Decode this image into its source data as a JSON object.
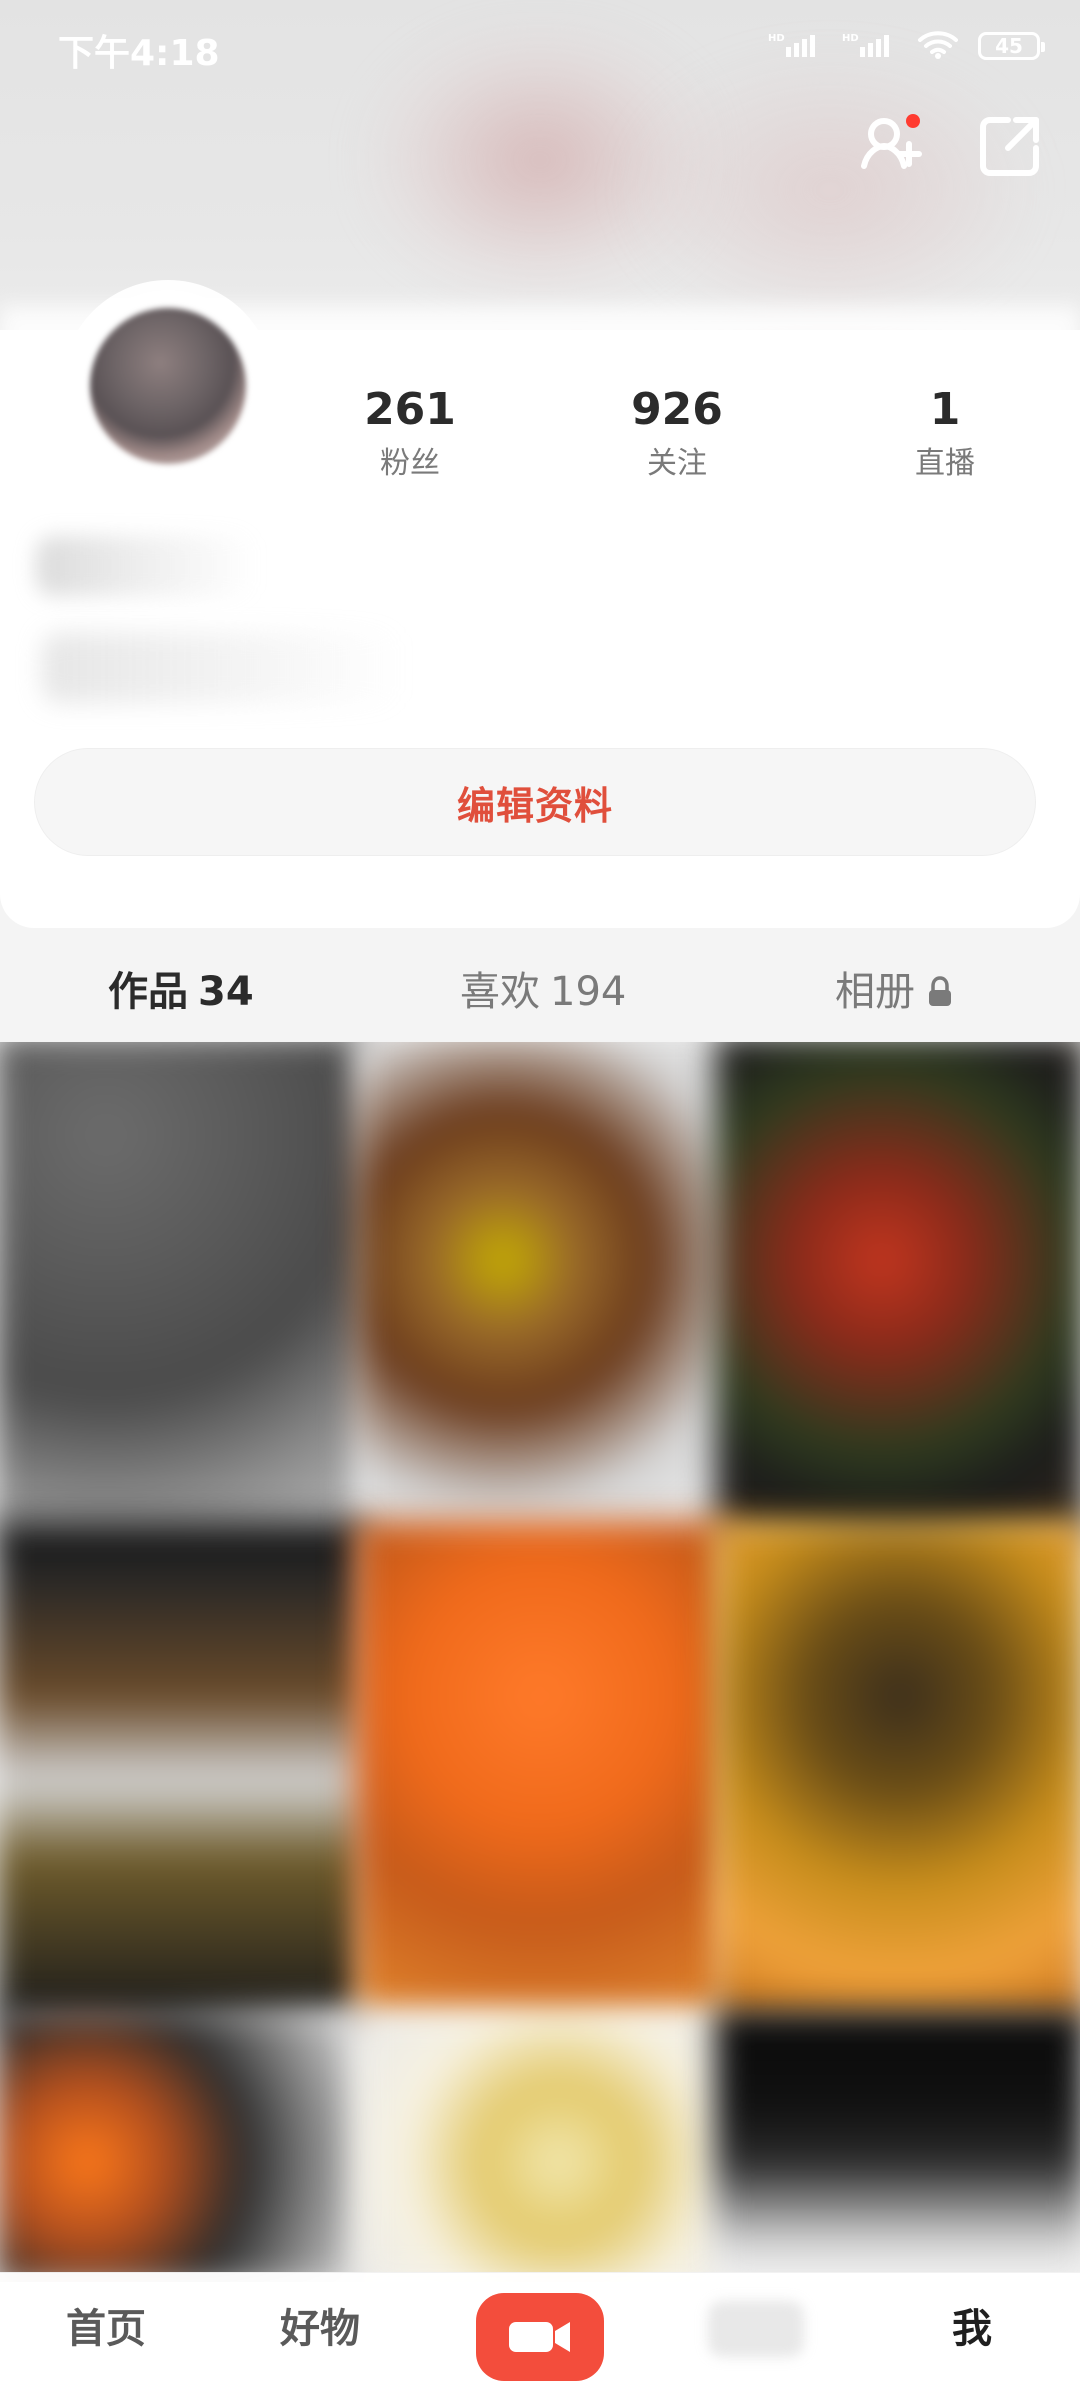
{
  "status_bar": {
    "time": "下午4:18",
    "battery_level": "45",
    "icons": [
      "signal-hd-icon",
      "signal-hd-icon",
      "wifi-icon",
      "battery-icon"
    ]
  },
  "top_actions": {
    "add_friend_icon": "add-user-icon",
    "share_icon": "share-icon",
    "notification_dot_color": "#ff3b30"
  },
  "profile": {
    "stats": [
      {
        "value": "261",
        "label": "粉丝"
      },
      {
        "value": "926",
        "label": "关注"
      },
      {
        "value": "1",
        "label": "直播"
      }
    ],
    "edit_button_label": "编辑资料"
  },
  "tabs": [
    {
      "label": "作品",
      "count": "34",
      "active": true
    },
    {
      "label": "喜欢",
      "count": "194",
      "active": false
    },
    {
      "label": "相册",
      "icon": "lock-icon",
      "active": false
    }
  ],
  "bottom_nav": {
    "home": "首页",
    "goods": "好物",
    "me": "我",
    "camera_icon": "video-camera-icon"
  },
  "colors": {
    "accent": "#e04f3c",
    "camera_button": "#f34d3c",
    "text_primary": "#2b2b2b",
    "text_secondary": "#7a7a7a"
  }
}
